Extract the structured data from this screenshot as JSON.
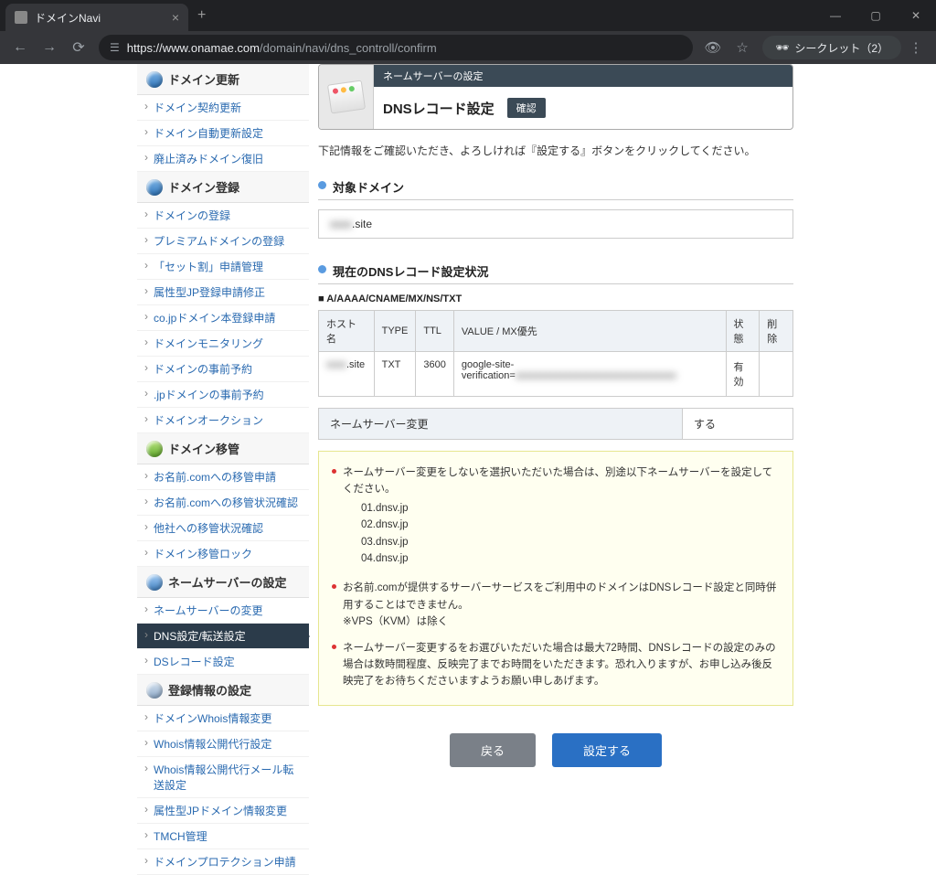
{
  "browser": {
    "tab_title": "ドメインNavi",
    "url_host": "https://www.onamae.com",
    "url_path": "/domain/navi/dns_controll/confirm",
    "incognito_label": "シークレット（2）"
  },
  "sidebar": {
    "sections": [
      {
        "title": "ドメイン更新",
        "icon": "blue-arrow",
        "items": [
          "ドメイン契約更新",
          "ドメイン自動更新設定",
          "廃止済みドメイン復旧"
        ]
      },
      {
        "title": "ドメイン登録",
        "icon": "blue-plus",
        "items": [
          "ドメインの登録",
          "プレミアムドメインの登録",
          "「セット割」申請管理",
          "属性型JP登録申請修正",
          "co.jpドメイン本登録申請",
          "ドメインモニタリング",
          "ドメインの事前予約",
          ".jpドメインの事前予約",
          "ドメインオークション"
        ]
      },
      {
        "title": "ドメイン移管",
        "icon": "green",
        "items": [
          "お名前.comへの移管申請",
          "お名前.comへの移管状況確認",
          "他社への移管状況確認",
          "ドメイン移管ロック"
        ]
      },
      {
        "title": "ネームサーバーの設定",
        "icon": "person",
        "items": [
          "ネームサーバーの変更",
          "DNS設定/転送設定",
          "DSレコード設定"
        ],
        "active_index": 1
      },
      {
        "title": "登録情報の設定",
        "icon": "doc",
        "items": [
          "ドメインWhois情報変更",
          "Whois情報公開代行設定",
          "Whois情報公開代行メール転送設定",
          "属性型JPドメイン情報変更",
          "TMCH管理",
          "ドメインプロテクション申請"
        ]
      }
    ]
  },
  "panel": {
    "bar": "ネームサーバーの設定",
    "title": "DNSレコード設定",
    "badge": "確認"
  },
  "instruction": "下記情報をご確認いただき、よろしければ『設定する』ボタンをクリックしてください。",
  "sections": {
    "target_domain": {
      "head": "対象ドメイン",
      "value_prefix_masked": "xxxx",
      "value_suffix": ".site"
    },
    "records": {
      "head": "現在のDNSレコード設定状況",
      "subhead": "A/AAAA/CNAME/MX/NS/TXT"
    }
  },
  "table": {
    "headers": [
      "ホスト名",
      "TYPE",
      "TTL",
      "VALUE / MX優先",
      "状態",
      "削除"
    ],
    "row": {
      "host_prefix_masked": "xxxx",
      "host_suffix": ".site",
      "type": "TXT",
      "ttl": "3600",
      "value_prefix": "google-site-verification=",
      "value_masked": "xxxxxxxxxxxxxxxxxxxxxxxxxxxxxxxx",
      "status": "有効",
      "delete": ""
    }
  },
  "ns_change": {
    "label": "ネームサーバー変更",
    "value": "する"
  },
  "notices": {
    "n1": "ネームサーバー変更をしないを選択いただいた場合は、別途以下ネームサーバーを設定してください。",
    "ns": [
      "01.dnsv.jp",
      "02.dnsv.jp",
      "03.dnsv.jp",
      "04.dnsv.jp"
    ],
    "n2": "お名前.comが提供するサーバーサービスをご利用中のドメインはDNSレコード設定と同時併用することはできません。",
    "n2b": "※VPS（KVM）は除く",
    "n3": "ネームサーバー変更するをお選びいただいた場合は最大72時間、DNSレコードの設定のみの場合は数時間程度、反映完了までお時間をいただきます。恐れ入りますが、お申し込み後反映完了をお待ちくださいますようお願い申しあげます。"
  },
  "buttons": {
    "back": "戻る",
    "submit": "設定する"
  }
}
